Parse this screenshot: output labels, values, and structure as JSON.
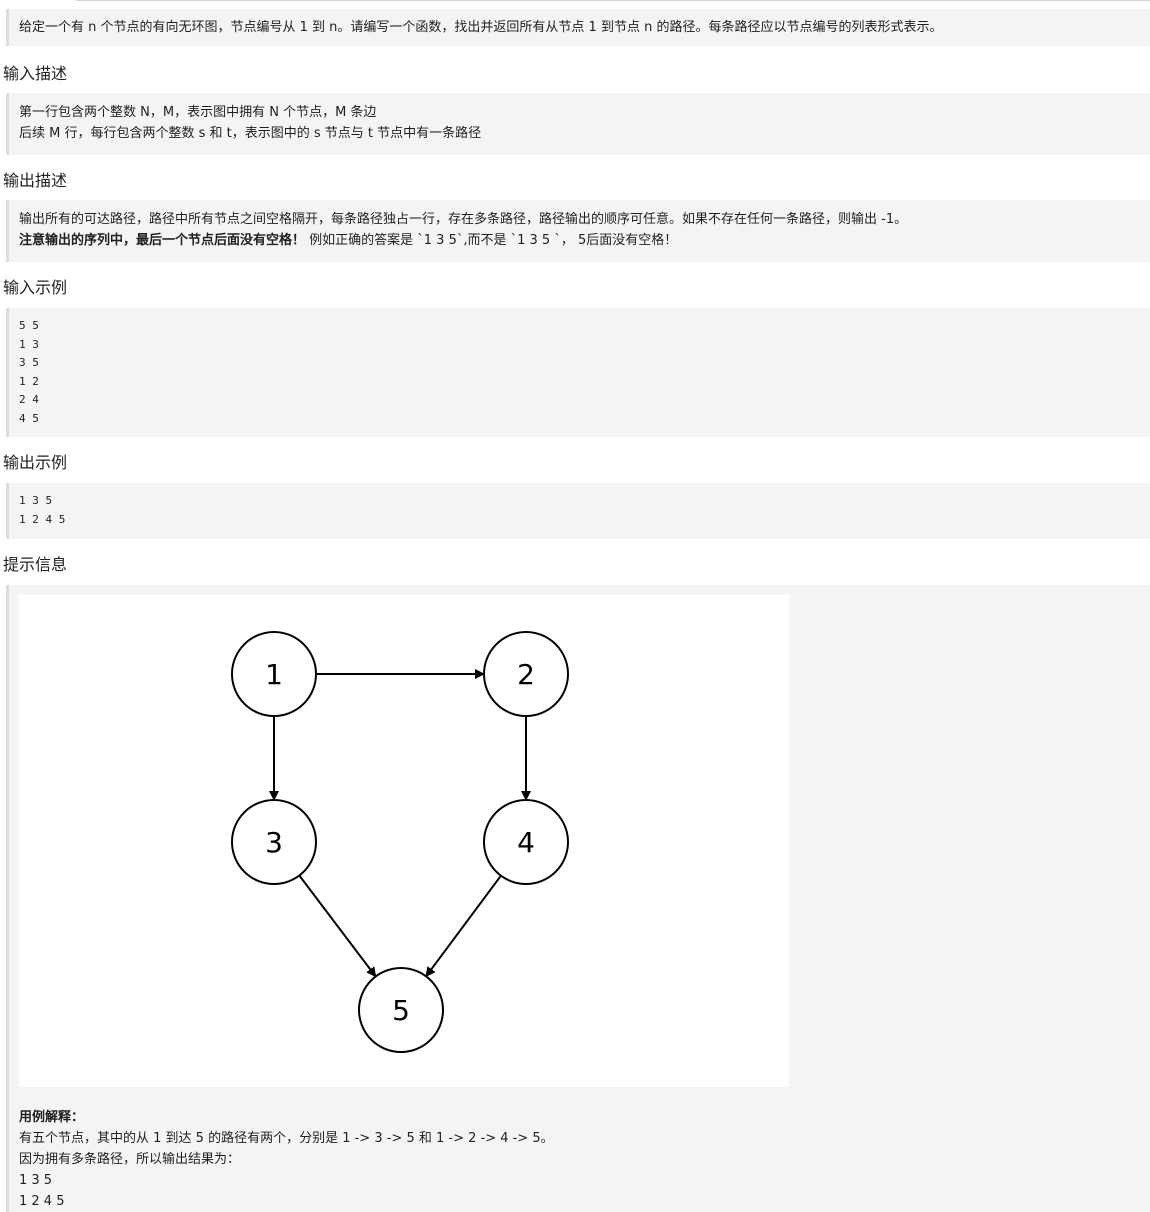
{
  "problem_description": "给定一个有 n 个节点的有向无环图，节点编号从 1 到 n。请编写一个函数，找出并返回所有从节点 1 到节点 n 的路径。每条路径应以节点编号的列表形式表示。",
  "input_heading": "输入描述",
  "input_lines": [
    "第一行包含两个整数 N，M，表示图中拥有 N 个节点，M 条边",
    "后续 M 行，每行包含两个整数 s 和 t，表示图中的 s 节点与 t 节点中有一条路径"
  ],
  "output_heading": "输出描述",
  "output_line1": "输出所有的可达路径，路径中所有节点之间空格隔开，每条路径独占一行，存在多条路径，路径输出的顺序可任意。如果不存在任何一条路径，则输出 -1。",
  "output_note_bold": "注意输出的序列中，最后一个节点后面没有空格！",
  "output_note_rest": " 例如正确的答案是 `1 3 5`,而不是 `1 3 5 `， 5后面没有空格！",
  "sample_input_heading": "输入示例",
  "sample_input": [
    "5 5",
    "1 3",
    "3 5",
    "1 2",
    "2 4",
    "4 5"
  ],
  "sample_output_heading": "输出示例",
  "sample_output": [
    "1 3 5",
    "1 2 4 5"
  ],
  "hint_heading": "提示信息",
  "graph": {
    "nodes": [
      "1",
      "2",
      "3",
      "4",
      "5"
    ],
    "edges": [
      [
        "1",
        "2"
      ],
      [
        "1",
        "3"
      ],
      [
        "2",
        "4"
      ],
      [
        "3",
        "5"
      ],
      [
        "4",
        "5"
      ]
    ]
  },
  "explanation_title": "用例解释：",
  "explanation_lines": [
    "有五个节点，其中的从 1 到达 5 的路径有两个，分别是 1 -> 3 -> 5 和 1 -> 2 -> 4 -> 5。",
    "因为拥有多条路径，所以输出结果为：",
    "1 3 5",
    "1 2 4 5"
  ]
}
